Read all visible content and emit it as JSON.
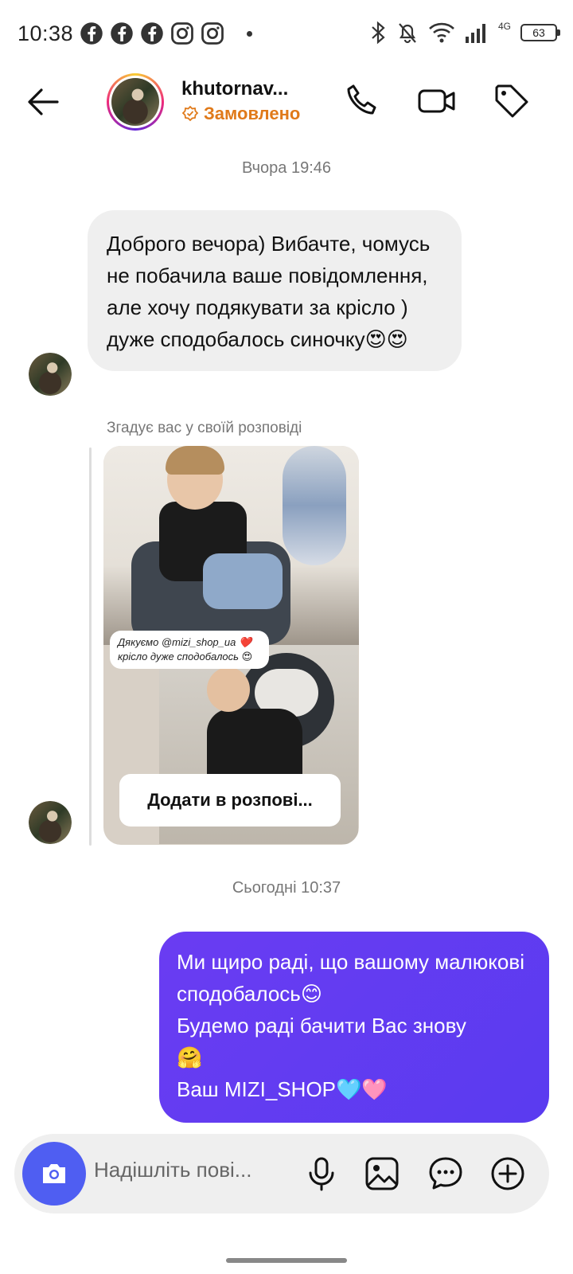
{
  "status_bar": {
    "time": "10:38",
    "network": "4G",
    "battery": "63",
    "left_icons": [
      "facebook-icon",
      "facebook-icon",
      "facebook-icon",
      "instagram-icon",
      "instagram-icon"
    ],
    "right_icons": [
      "bluetooth-icon",
      "mute-icon",
      "wifi-icon",
      "signal-icon",
      "battery-icon"
    ]
  },
  "header": {
    "username": "khutornav...",
    "subtitle": "Замовлено",
    "buttons": [
      "back-arrow-icon",
      "phone-icon",
      "video-icon",
      "tag-icon"
    ]
  },
  "chat": {
    "timestamp_1": "Вчора 19:46",
    "incoming_message": "Доброго вечора)  Вибачте, чомусь не побачила ваше повідомлення, але хочу подякувати за крісло ) дуже сподобалось синочку😍😍",
    "story_mention": "Згадує вас у своїй розповіді",
    "story_caption": "Дякуємо @mizi_shop_ua ❤️ крісло дуже сподобалось 😍",
    "add_to_story": "Додати в розпові...",
    "timestamp_2": "Сьогодні 10:37",
    "outgoing_message": "Ми щиро раді, що вашому малюкові сподобалось😊\nБудемо раді бачити Вас знову\n🤗\nВаш MIZI_SHOP🩵🩷"
  },
  "composer": {
    "placeholder": "Надішліть пові...",
    "icons": [
      "camera-icon",
      "microphone-icon",
      "gallery-icon",
      "sticker-icon",
      "plus-icon"
    ]
  },
  "colors": {
    "accent_purple": "#5a3bf0",
    "camera_blue": "#4f5ef2",
    "ordered_orange": "#e07a1a",
    "bubble_gray": "#efefef"
  }
}
